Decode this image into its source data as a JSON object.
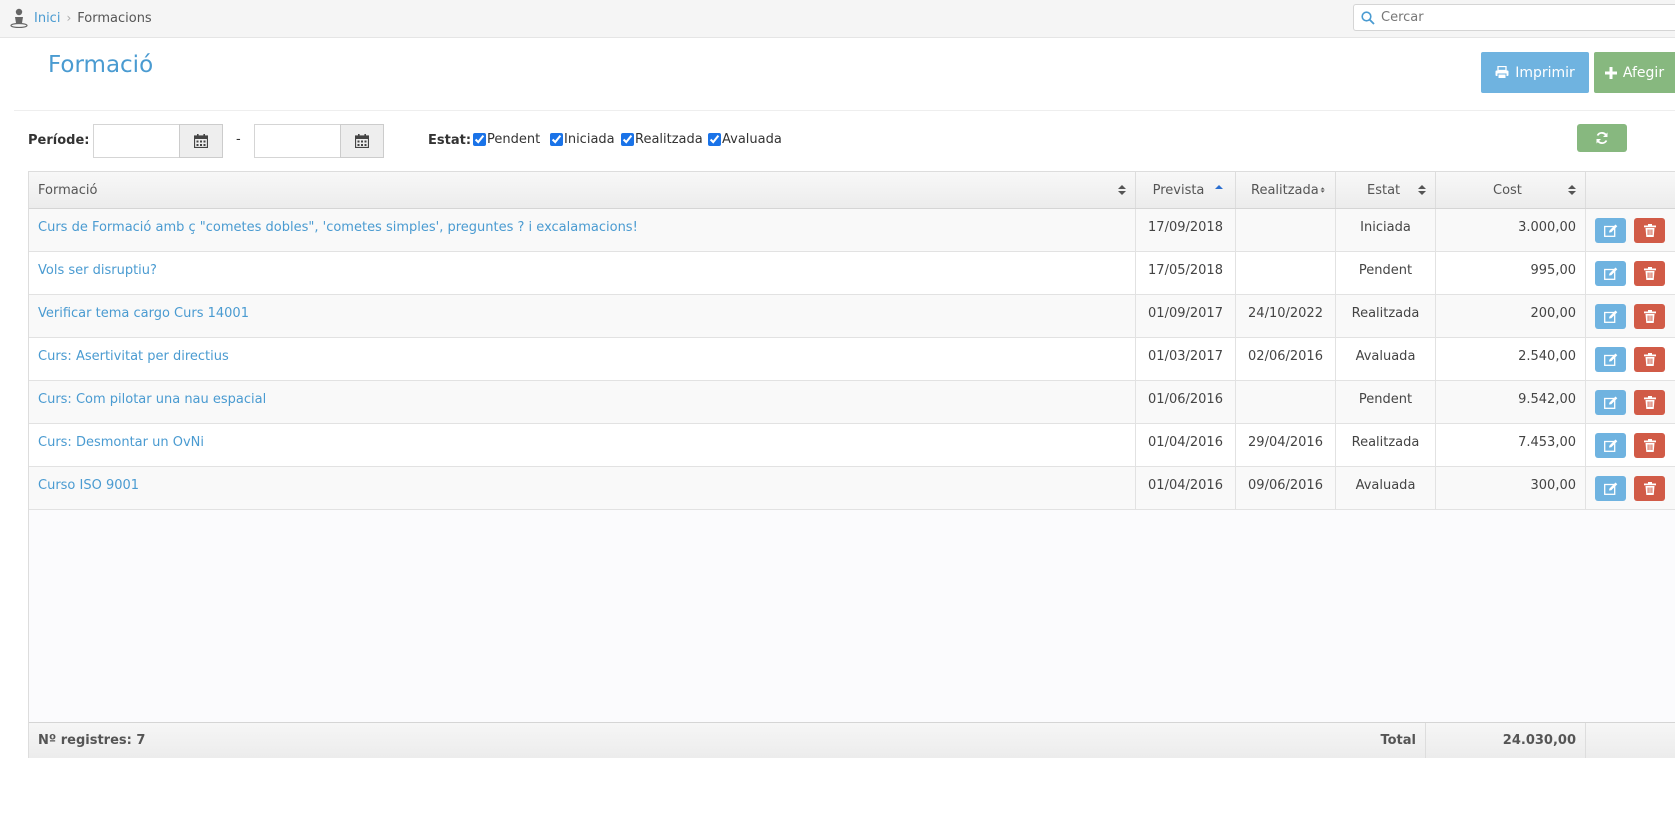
{
  "breadcrumb": {
    "home": "Inici",
    "current": "Formacions"
  },
  "search": {
    "placeholder": "Cercar"
  },
  "header": {
    "title": "Formació",
    "print_label": "Imprimir",
    "add_label": "Afegir"
  },
  "filters": {
    "period_label": "Període:",
    "range_sep": "-",
    "status_label": "Estat:",
    "statuses": [
      {
        "label": "Pendent",
        "checked": true
      },
      {
        "label": "Iniciada",
        "checked": true
      },
      {
        "label": "Realitzada",
        "checked": true
      },
      {
        "label": "Avaluada",
        "checked": true
      }
    ]
  },
  "table": {
    "columns": [
      "Formació",
      "Prevista",
      "Realitzada",
      "Estat",
      "Cost"
    ],
    "rows": [
      {
        "name": "Curs de Formació amb ç \"cometes dobles\", 'cometes simples', preguntes ? i excalamacions!",
        "planned": "17/09/2018",
        "done": "",
        "status": "Iniciada",
        "cost": "3.000,00"
      },
      {
        "name": "Vols ser disruptiu?",
        "planned": "17/05/2018",
        "done": "",
        "status": "Pendent",
        "cost": "995,00"
      },
      {
        "name": "Verificar tema cargo Curs 14001",
        "planned": "01/09/2017",
        "done": "24/10/2022",
        "status": "Realitzada",
        "cost": "200,00"
      },
      {
        "name": "Curs: Asertivitat per directius",
        "planned": "01/03/2017",
        "done": "02/06/2016",
        "status": "Avaluada",
        "cost": "2.540,00"
      },
      {
        "name": "Curs: Com pilotar una nau espacial",
        "planned": "01/06/2016",
        "done": "",
        "status": "Pendent",
        "cost": "9.542,00"
      },
      {
        "name": "Curs: Desmontar un OvNi",
        "planned": "01/04/2016",
        "done": "29/04/2016",
        "status": "Realitzada",
        "cost": "7.453,00"
      },
      {
        "name": "Curso ISO 9001",
        "planned": "01/04/2016",
        "done": "09/06/2016",
        "status": "Avaluada",
        "cost": "300,00"
      }
    ],
    "footer": {
      "count": "Nº registres: 7",
      "total_label": "Total",
      "total": "24.030,00"
    }
  },
  "colors": {
    "accent": "#4a9bd1",
    "blue_button": "#6fb3e0",
    "green_button": "#87b87f",
    "red_button": "#d15b47"
  },
  "icons": [
    "user-icon",
    "search-icon",
    "print-icon",
    "plus-icon",
    "calendar-icon",
    "refresh-icon",
    "sort-icon",
    "sort-asc-icon",
    "edit-icon",
    "trash-icon"
  ]
}
